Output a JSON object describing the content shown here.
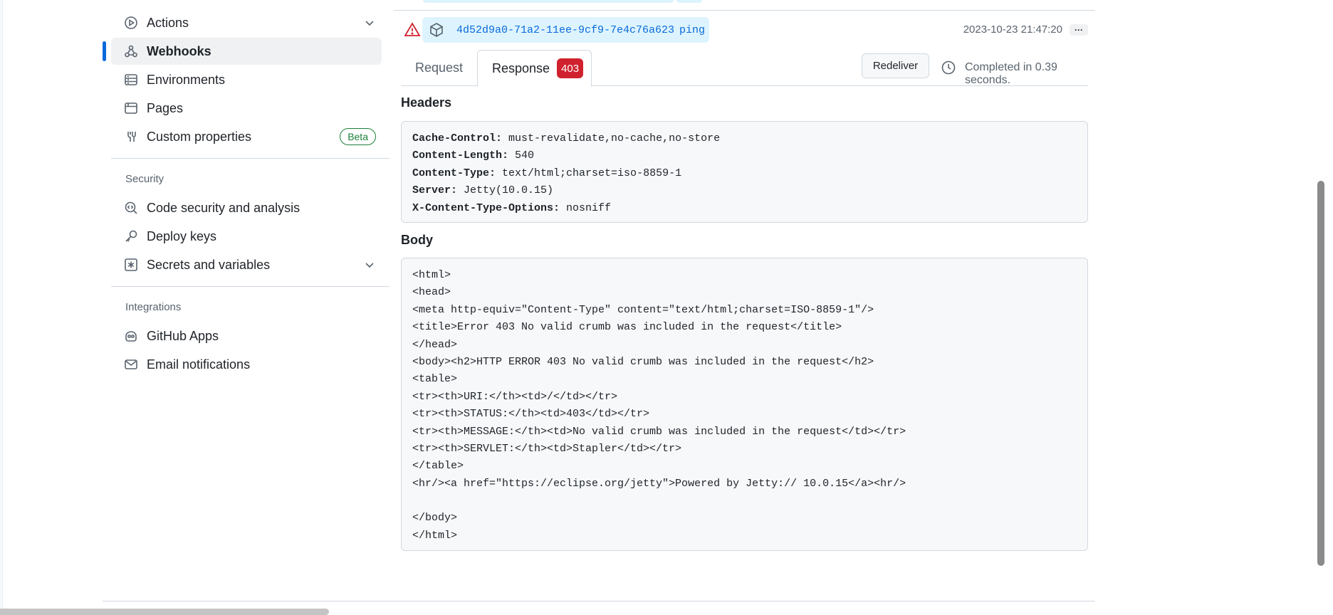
{
  "sidebar": {
    "items": [
      {
        "label": "Actions",
        "icon": "play-icon"
      },
      {
        "label": "Webhooks",
        "icon": "webhook-icon"
      },
      {
        "label": "Environments",
        "icon": "server-icon"
      },
      {
        "label": "Pages",
        "icon": "browser-icon"
      },
      {
        "label": "Custom properties",
        "icon": "tools-icon",
        "badge": "Beta"
      },
      {
        "label": "Code security and analysis",
        "icon": "codescan-icon"
      },
      {
        "label": "Deploy keys",
        "icon": "key-icon"
      },
      {
        "label": "Secrets and variables",
        "icon": "asterisk-icon"
      },
      {
        "label": "GitHub Apps",
        "icon": "copilot-icon"
      },
      {
        "label": "Email notifications",
        "icon": "mail-icon"
      }
    ],
    "sections": {
      "security": "Security",
      "integrations": "Integrations"
    }
  },
  "delivery": {
    "guid": "4d52d9a0-71a2-11ee-9cf9-7e4c76a623df",
    "event": "ping",
    "timestamp": "2023-10-23 21:47:20",
    "more_label": "···"
  },
  "tabs": {
    "request": "Request",
    "response": "Response",
    "status_code": "403"
  },
  "actions": {
    "redeliver": "Redeliver",
    "completed": "Completed in 0.39 seconds."
  },
  "headers": {
    "title": "Headers",
    "rows": [
      {
        "key": "Cache-Control:",
        "value": " must-revalidate,no-cache,no-store"
      },
      {
        "key": "Content-Length:",
        "value": " 540"
      },
      {
        "key": "Content-Type:",
        "value": " text/html;charset=iso-8859-1"
      },
      {
        "key": "Server:",
        "value": " Jetty(10.0.15)"
      },
      {
        "key": "X-Content-Type-Options:",
        "value": " nosniff"
      }
    ]
  },
  "body": {
    "title": "Body",
    "lines": [
      "<html>",
      "<head>",
      "<meta http-equiv=\"Content-Type\" content=\"text/html;charset=ISO-8859-1\"/>",
      "<title>Error 403 No valid crumb was included in the request</title>",
      "</head>",
      "<body><h2>HTTP ERROR 403 No valid crumb was included in the request</h2>",
      "<table>",
      "<tr><th>URI:</th><td>/</td></tr>",
      "<tr><th>STATUS:</th><td>403</td></tr>",
      "<tr><th>MESSAGE:</th><td>No valid crumb was included in the request</td></tr>",
      "<tr><th>SERVLET:</th><td>Stapler</td></tr>",
      "</table>",
      "<hr/><a href=\"https://eclipse.org/jetty\">Powered by Jetty:// 10.0.15</a><hr/>",
      "",
      "</body>",
      "</html>"
    ]
  },
  "colors": {
    "accent": "#0969da",
    "danger": "#cf222e",
    "success": "#1a7f37",
    "chip_bg": "#ddf4ff"
  }
}
